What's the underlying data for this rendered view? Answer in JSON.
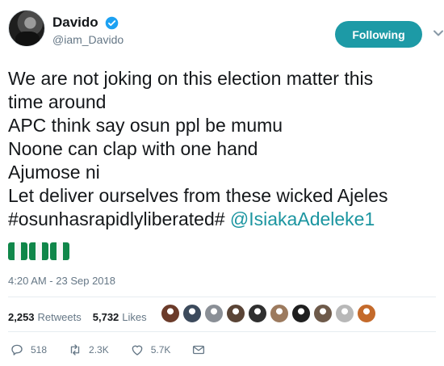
{
  "user": {
    "display_name": "Davido",
    "handle": "@iam_Davido",
    "verified": true
  },
  "follow_button": {
    "label": "Following"
  },
  "tweet": {
    "lines": [
      "We are not joking on this election matter this",
      "time around",
      "APC think say osun ppl be mumu",
      "Noone can clap with one hand",
      "Ajumose ni",
      "Let deliver ourselves from these wicked Ajeles"
    ],
    "hashtag_text": "#osunhasrapidlyliberated#",
    "mention": "@IsiakaAdeleke1",
    "emoji": [
      "nigeria-flag",
      "nigeria-flag",
      "nigeria-flag"
    ]
  },
  "timestamp": "4:20 AM - 23 Sep 2018",
  "stats": {
    "retweets_count": "2,253",
    "retweets_label": "Retweets",
    "likes_count": "5,732",
    "likes_label": "Likes"
  },
  "likers": [
    {
      "icon": "avatar",
      "color": "#6b3b2a"
    },
    {
      "icon": "avatar",
      "color": "#3c4a5c"
    },
    {
      "icon": "avatar",
      "color": "#8a8f96"
    },
    {
      "icon": "avatar",
      "color": "#5a4436"
    },
    {
      "icon": "avatar",
      "color": "#2f2f2f"
    },
    {
      "icon": "avatar",
      "color": "#9c7a5e"
    },
    {
      "icon": "avatar",
      "color": "#1f1f1f"
    },
    {
      "icon": "avatar",
      "color": "#6e5a4a"
    },
    {
      "icon": "avatar",
      "color": "#b8b8b8"
    },
    {
      "icon": "avatar",
      "color": "#c46a2b"
    }
  ],
  "actions": {
    "replies": "518",
    "retweets": "2.3K",
    "likes": "5.7K"
  },
  "colors": {
    "accent": "#1d9aa6",
    "link": "#1b95a0",
    "verified": "#1da1f2",
    "muted": "#657786"
  }
}
